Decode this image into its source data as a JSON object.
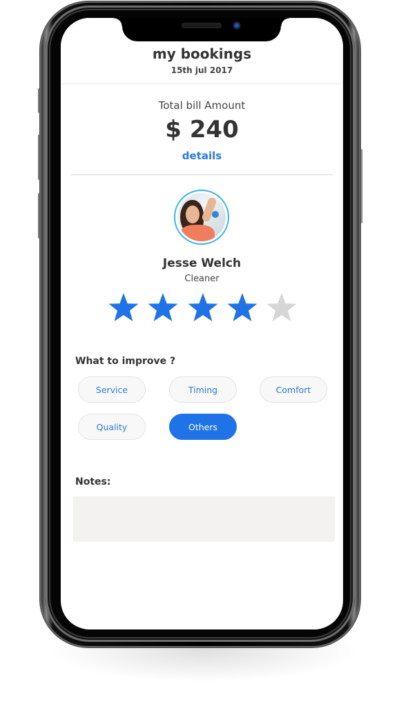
{
  "header": {
    "title": "my bookings",
    "date": "15th jul 2017"
  },
  "bill": {
    "label": "Total bill Amount",
    "amount": "$ 240",
    "details_link": "details"
  },
  "provider": {
    "avatar_icon": "person-photo",
    "name": "Jesse Welch",
    "role": "Cleaner",
    "rating": 4,
    "rating_max": 5
  },
  "improve": {
    "label": "What to improve ?",
    "options": [
      {
        "label": "Service",
        "selected": false
      },
      {
        "label": "Timing",
        "selected": false
      },
      {
        "label": "Comfort",
        "selected": false
      },
      {
        "label": "Quality",
        "selected": false
      },
      {
        "label": "Others",
        "selected": true
      }
    ]
  },
  "notes": {
    "label": "Notes:",
    "value": "",
    "placeholder": ""
  },
  "colors": {
    "accent": "#1f73e6",
    "link": "#2a7ae2",
    "star_filled": "#1f73e6",
    "star_empty": "#d6d6d6",
    "avatar_ring": "#33b5e5",
    "notes_bg": "#f3f2f1"
  }
}
